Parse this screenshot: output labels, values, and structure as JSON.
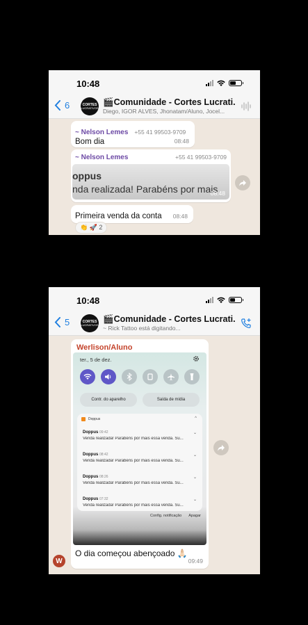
{
  "screen1": {
    "time": "10:48",
    "back_count": "6",
    "avatar_text": "CORTES",
    "avatar_sub": "LUCRATIVOS",
    "group_title": "🎬Comunidade - Cortes Lucrati...",
    "group_subtitle": "Diego, IGOR ALVES, Jhonatam/Aluno, Jocel...",
    "messages": [
      {
        "sender": "~ Nelson Lemes",
        "phone": "+55 41 99503-9709",
        "text": "Bom dia",
        "time": "08:48"
      },
      {
        "sender": "~ Nelson Lemes",
        "phone": "+55 41 99503-9709",
        "preview_title": "oppus",
        "preview_text": "nda realizada! Parabéns por mais",
        "time": "08:48"
      },
      {
        "text": "Primeira venda da conta",
        "time": "08:48"
      }
    ],
    "reactions": "👏 🚀  2"
  },
  "screen2": {
    "time": "10:48",
    "back_count": "5",
    "avatar_text": "CORTES",
    "avatar_sub": "LUCRATIVOS",
    "group_title": "🎬Comunidade - Cortes Lucrati...",
    "group_subtitle": "~ Rick Tattoo está digitando...",
    "sender": "Werlison/Aluno",
    "phone_screenshot": {
      "date": "ter., 5 de dez.",
      "device_control": "Contr. do aparelho",
      "media_output": "Saída de mídia",
      "app_name": "Doppus",
      "notifications": [
        {
          "title": "Doppus",
          "time": "09:42",
          "body": "Venda realizada! Parabéns por mais essa venda. Su..."
        },
        {
          "title": "Doppus",
          "time": "08:42",
          "body": "Venda realizada! Parabéns por mais essa venda. Su..."
        },
        {
          "title": "Doppus",
          "time": "08:26",
          "body": "Venda realizada! Parabéns por mais essa venda. Su..."
        },
        {
          "title": "Doppus",
          "time": "07:32",
          "body": "Venda realizada! Parabéns por mais essa venda. Su..."
        }
      ],
      "notification_settings": "Config. notificação",
      "clear": "Apagar"
    },
    "caption": "O dia começou abençoado 🙏🏻",
    "time_sent": "09:49",
    "avatar_letter": "W"
  },
  "colors": {
    "chat_bg": "#efe7de",
    "accent_blue": "#1f7fe0",
    "sender_purple": "#6d4aa5",
    "sender_red": "#c4442c",
    "toggle_on": "#5f57c7"
  }
}
